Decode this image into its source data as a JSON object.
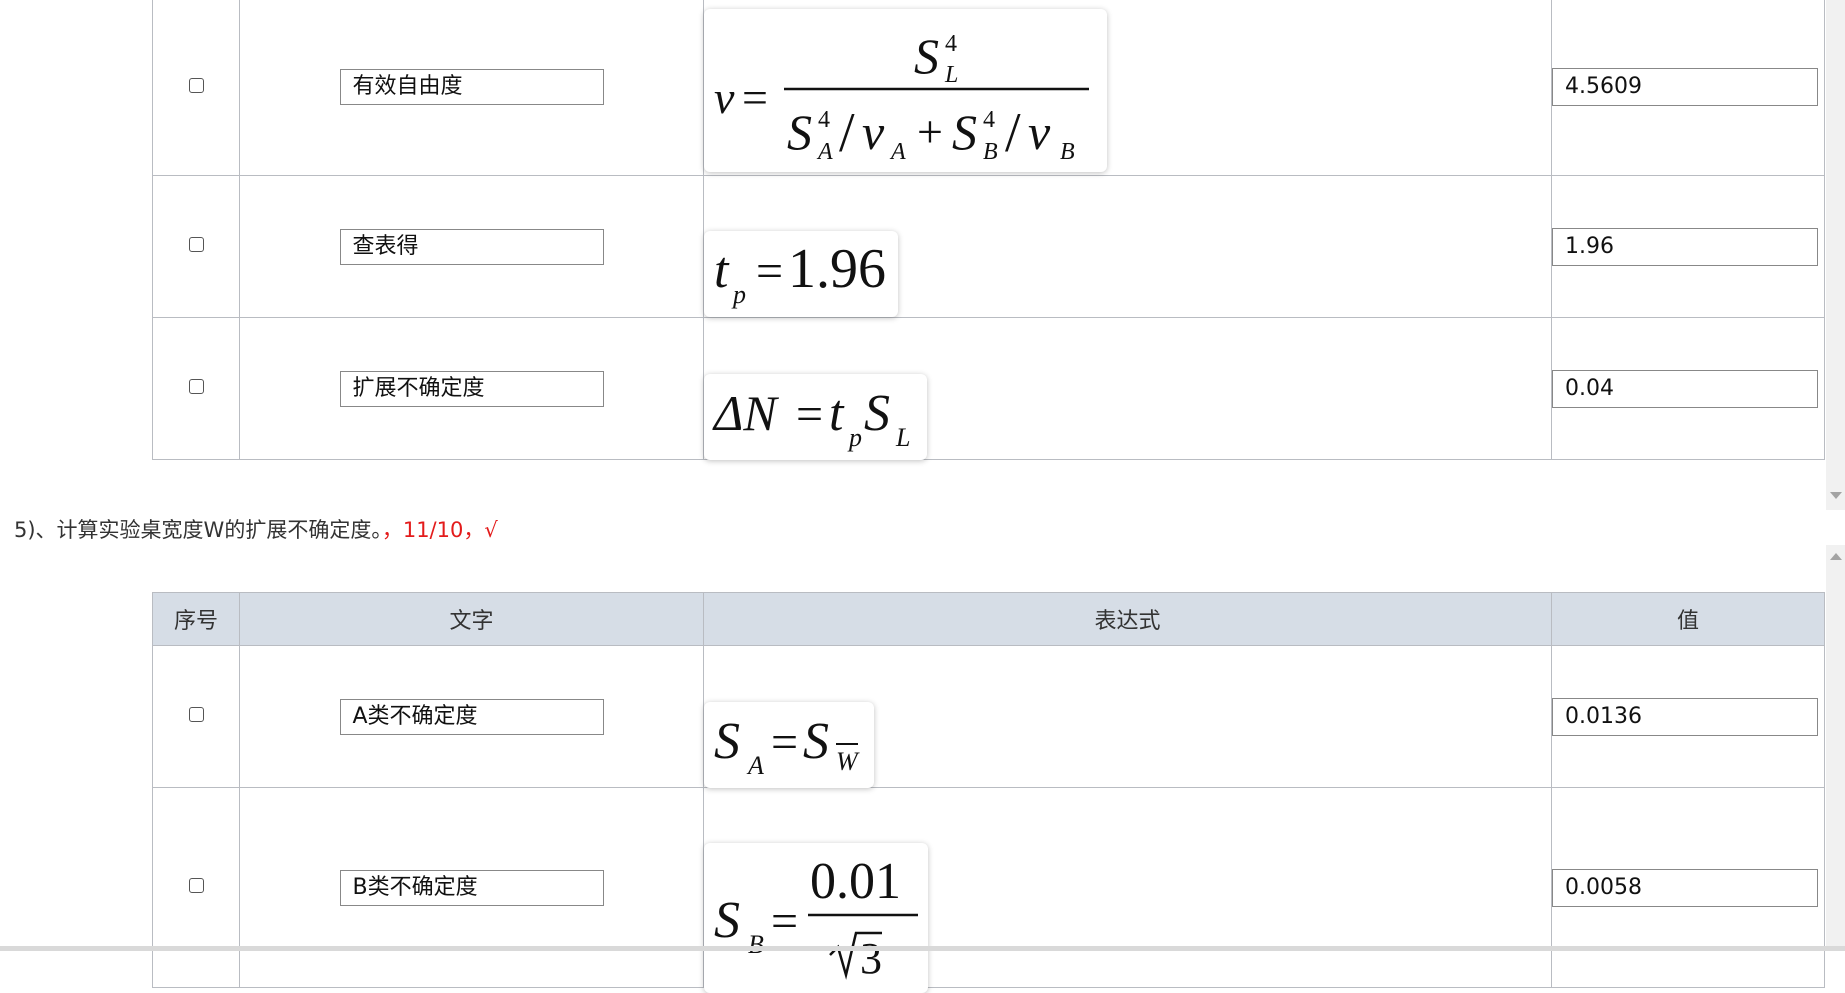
{
  "table1": {
    "rows": [
      {
        "text": "有效自由度",
        "value": "4.5609",
        "formula": "v = S_L^4 / (S_A^4/v_A + S_B^4/v_B)"
      },
      {
        "text": "查表得",
        "value": "1.96",
        "formula": "t_p = 1.96"
      },
      {
        "text": "扩展不确定度",
        "value": "0.04",
        "formula": "ΔN = t_p S_L"
      }
    ]
  },
  "question": {
    "text": "5)、计算实验桌宽度W的扩展不确定度。",
    "score": "，11/10，√",
    "score_color": "#e31b1b"
  },
  "table2": {
    "headers": {
      "index": "序号",
      "text": "文字",
      "expr": "表达式",
      "value": "值"
    },
    "header_bg": "#d6dde6",
    "rows": [
      {
        "text": "A类不确定度",
        "value": "0.0136",
        "formula": "S_A = S_W̄"
      },
      {
        "text": "B类不确定度",
        "value": "0.0058",
        "formula": "S_B = 0.01 / √3"
      }
    ]
  },
  "equations": {
    "free_v": "v",
    "free_eq": "=",
    "free_SL": "S",
    "free_4": "4",
    "free_L": "L",
    "free_S1": "S",
    "free_A": "A",
    "free_slash": "/",
    "free_v1": "v",
    "free_A2": "A",
    "free_plus": "+",
    "free_S2": "S",
    "free_B": "B",
    "free_v2": "v",
    "free_B2": "B",
    "t_t": "t",
    "t_p": "p",
    "t_eq": "=",
    "t_val": "1.96",
    "d_delta": "ΔN",
    "d_eq": "=",
    "d_t": "t",
    "d_p": "p",
    "d_S": "S",
    "d_L": "L",
    "a_S": "S",
    "a_A": "A",
    "a_eq": "=",
    "a_S2": "S",
    "a_W": "W",
    "b_S": "S",
    "b_B": "B",
    "b_eq": "=",
    "b_num": "0.01",
    "b_den": "3"
  }
}
